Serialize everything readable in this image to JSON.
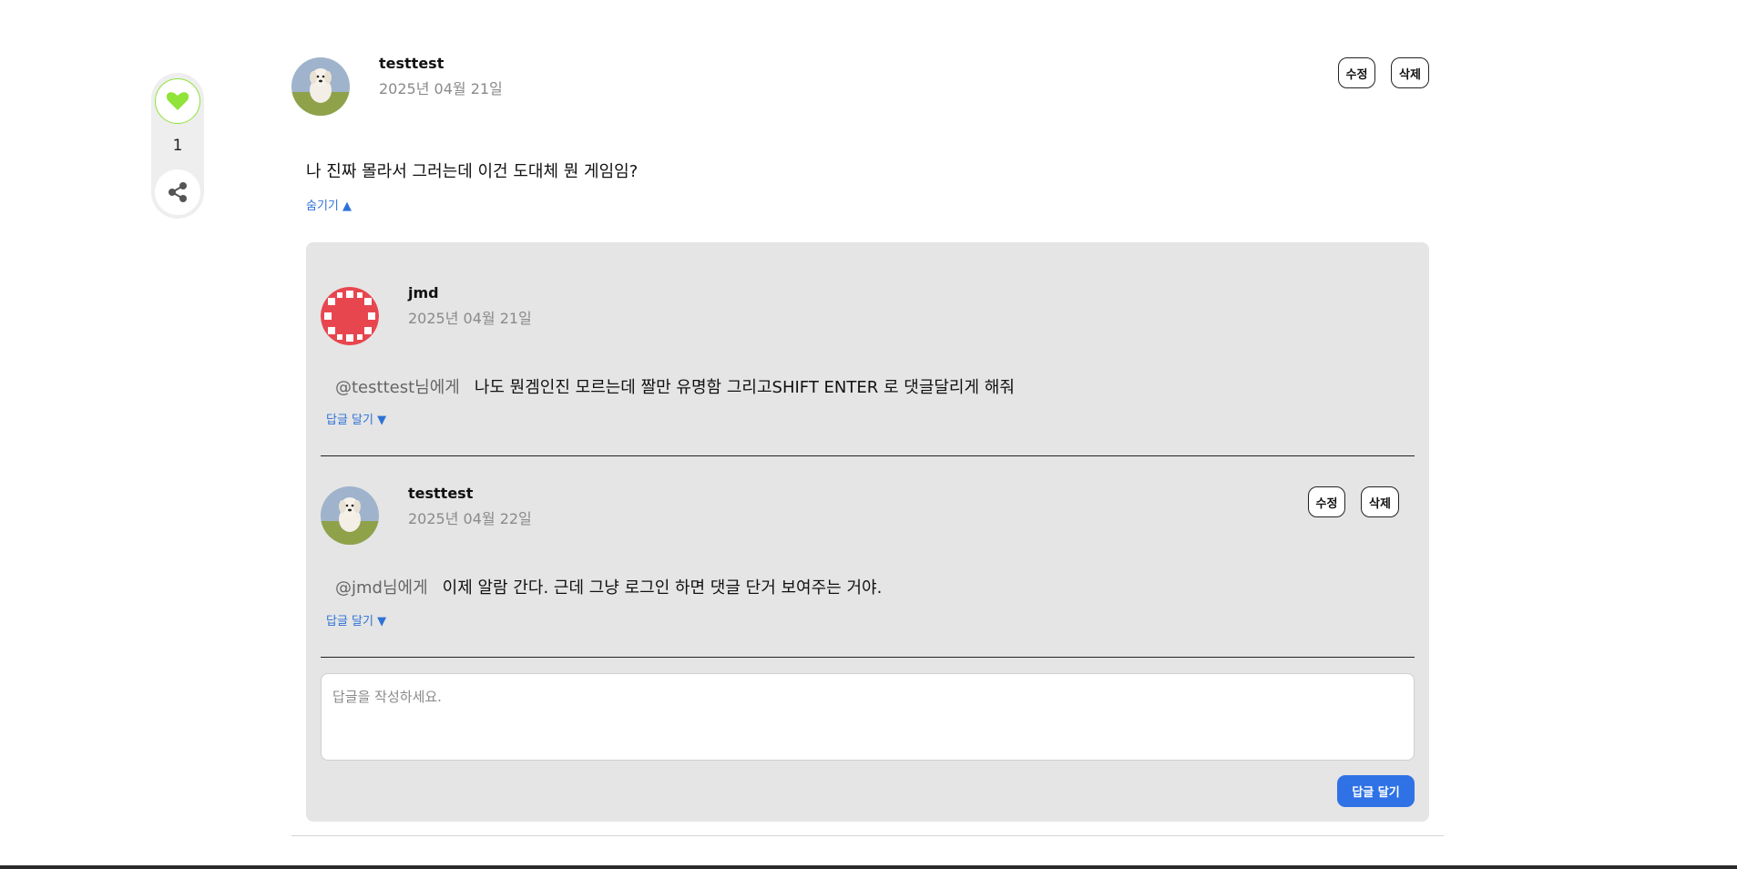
{
  "sidebar": {
    "like_count": "1",
    "like_icon": "heart-icon",
    "share_icon": "share-icon",
    "accent_color": "#8fe339"
  },
  "post": {
    "author": "testtest",
    "date": "2025년 04월 21일",
    "edit_label": "수정",
    "delete_label": "삭제",
    "content": "나 진짜 몰라서 그러는데 이건 도대체 뭔 게임임?",
    "toggle_label": "숨기기 ▲"
  },
  "replies": [
    {
      "author": "jmd",
      "date": "2025년 04월 21일",
      "mention": "@testtest님에게",
      "content": "나도 뭔겜인진 모르는데 짤만 유명함 그리고SHIFT ENTER 로 댓글달리게 해줘",
      "reply_toggle": "답글 달기 ▼"
    },
    {
      "author": "testtest",
      "date": "2025년 04월 22일",
      "mention": "@jmd님에게",
      "content": "이제 알람 간다. 근데 그냥 로그인 하면 댓글 단거 보여주는 거야.",
      "reply_toggle": "답글 달기 ▼",
      "edit_label": "수정",
      "delete_label": "삭제"
    }
  ],
  "reply_form": {
    "placeholder": "답글을 작성하세요.",
    "submit_label": "답글 달기",
    "button_color": "#2f72e6"
  }
}
